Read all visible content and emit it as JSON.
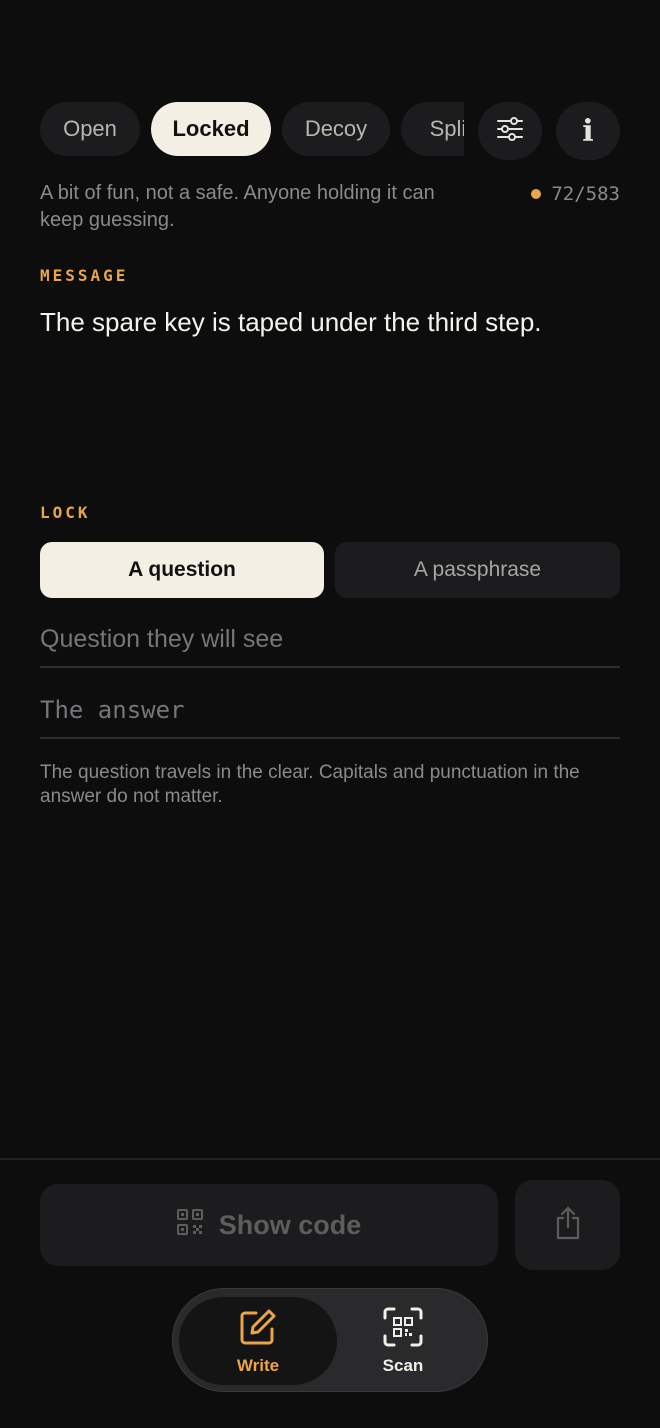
{
  "modes": {
    "tabs": [
      {
        "label": "Open",
        "active": false
      },
      {
        "label": "Locked",
        "active": true
      },
      {
        "label": "Decoy",
        "active": false
      },
      {
        "label": "Split",
        "active": false
      }
    ],
    "settings_icon": "sliders-icon",
    "info_icon": "info-icon",
    "info_glyph": "i"
  },
  "subtitle": "A bit of fun, not a safe. Anyone holding it can keep guessing.",
  "counter": "72/583",
  "message": {
    "label": "MESSAGE",
    "text": "The spare key is taped under the third step."
  },
  "lock": {
    "label": "LOCK",
    "options": [
      "A question",
      "A passphrase"
    ],
    "selected": "A question",
    "question_placeholder": "Question they will see",
    "answer_placeholder": "The answer",
    "hint": "The question travels in the clear. Capitals and punctuation in the answer do not matter."
  },
  "actions": {
    "show_code_label": "Show code",
    "share_icon": "share-icon"
  },
  "nav": {
    "write_label": "Write",
    "scan_label": "Scan"
  },
  "colors": {
    "accent": "#e8a54a",
    "background": "#0d0d0e",
    "surface": "#1c1c1e",
    "selected": "#f4efe4"
  }
}
